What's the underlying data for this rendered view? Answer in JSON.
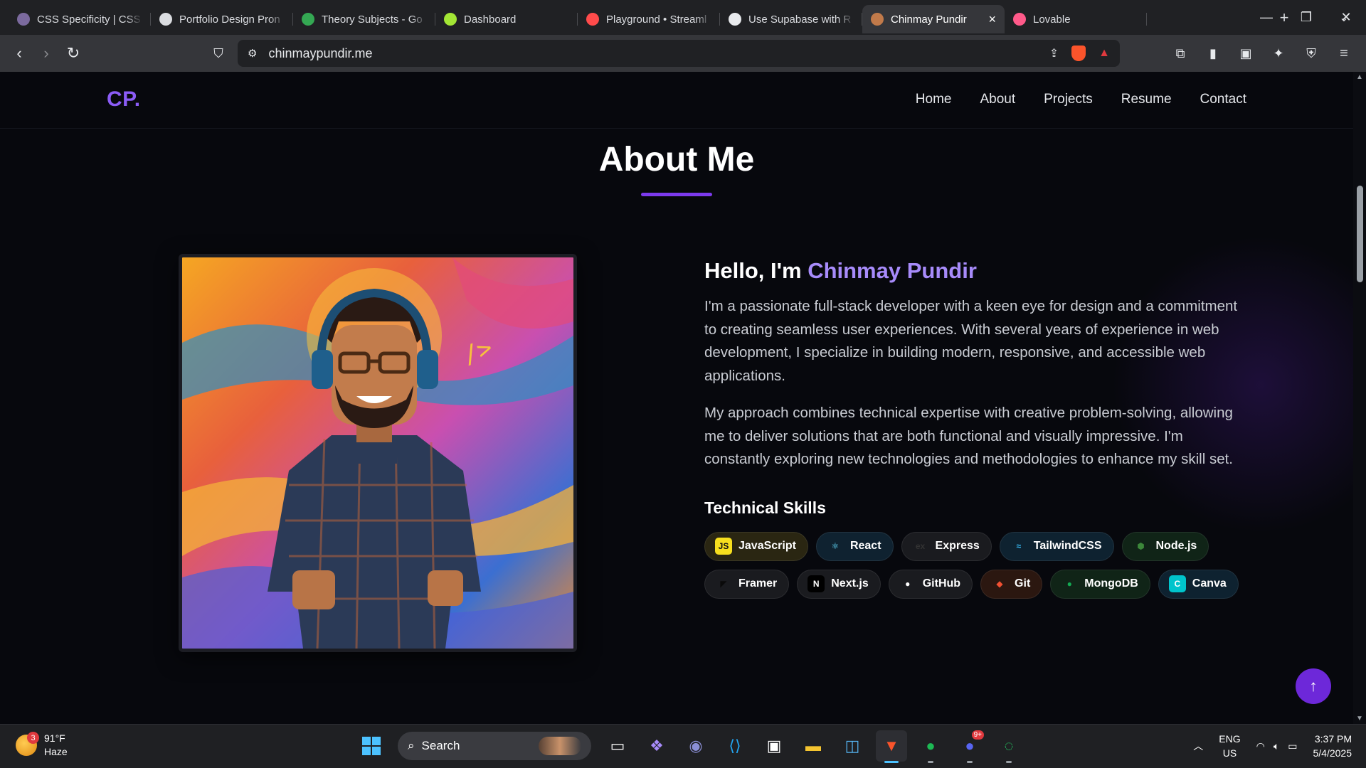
{
  "browser": {
    "tabs": [
      {
        "title": "CSS Specificity | CSS",
        "icon": "avatar-icon",
        "color": "#7b6a9e"
      },
      {
        "title": "Portfolio Design Pron",
        "icon": "openai-icon",
        "color": "#dadce0"
      },
      {
        "title": "Theory Subjects - Go",
        "icon": "google-drive-icon",
        "color": "#34a853"
      },
      {
        "title": "Dashboard",
        "icon": "bolt-icon",
        "color": "#a3e635"
      },
      {
        "title": "Playground • Streaml",
        "icon": "crown-icon",
        "color": "#ff4b4b"
      },
      {
        "title": "Use Supabase with R",
        "icon": "supabase-icon",
        "color": "#e8eaed"
      },
      {
        "title": "Chinmay Pundir",
        "icon": "avatar-icon",
        "color": "#c17a4a",
        "active": true
      },
      {
        "title": "Lovable",
        "icon": "lovable-icon",
        "color": "#ff5a8a"
      }
    ],
    "url": "chinmaypundir.me"
  },
  "site": {
    "logo": "CP.",
    "nav": [
      "Home",
      "About",
      "Projects",
      "Resume",
      "Contact"
    ],
    "section_title": "About Me",
    "accent": "#7c3aed",
    "greeting_prefix": "Hello, I'm ",
    "name": "Chinmay Pundir",
    "paragraphs": [
      "I'm a passionate full-stack developer with a keen eye for design and a commitment to creating seamless user experiences. With several years of experience in web development, I specialize in building modern, responsive, and accessible web applications.",
      "My approach combines technical expertise with creative problem-solving, allowing me to deliver solutions that are both functional and visually impressive. I'm constantly exploring new technologies and methodologies to enhance my skill set."
    ],
    "skills_title": "Technical Skills",
    "skills": [
      {
        "label": "JavaScript",
        "icon": "javascript-icon",
        "glyph": "JS",
        "bg": "#2a2612",
        "icon_bg": "#f7df1e",
        "icon_fg": "#111"
      },
      {
        "label": "React",
        "icon": "react-icon",
        "glyph": "⚛",
        "bg": "#0f2230",
        "icon_bg": "transparent",
        "icon_fg": "#61dafb"
      },
      {
        "label": "Express",
        "icon": "express-icon",
        "glyph": "ex",
        "bg": "#1a1b1f",
        "icon_bg": "transparent",
        "icon_fg": "#333"
      },
      {
        "label": "TailwindCSS",
        "icon": "tailwind-icon",
        "glyph": "≈",
        "bg": "#0e2230",
        "icon_bg": "transparent",
        "icon_fg": "#38bdf8"
      },
      {
        "label": "Node.js",
        "icon": "nodejs-icon",
        "glyph": "⬢",
        "bg": "#102417",
        "icon_bg": "transparent",
        "icon_fg": "#3c873a"
      },
      {
        "label": "Framer",
        "icon": "framer-icon",
        "glyph": "◤",
        "bg": "#1a1b1f",
        "icon_bg": "transparent",
        "icon_fg": "#0a0a0a"
      },
      {
        "label": "Next.js",
        "icon": "nextjs-icon",
        "glyph": "N",
        "bg": "#1a1b1f",
        "icon_bg": "#000",
        "icon_fg": "#fff"
      },
      {
        "label": "GitHub",
        "icon": "github-icon",
        "glyph": "●",
        "bg": "#1a1b1f",
        "icon_bg": "transparent",
        "icon_fg": "#fff"
      },
      {
        "label": "Git",
        "icon": "git-icon",
        "glyph": "◆",
        "bg": "#2b1710",
        "icon_bg": "transparent",
        "icon_fg": "#f05032"
      },
      {
        "label": "MongoDB",
        "icon": "mongodb-icon",
        "glyph": "●",
        "bg": "#102417",
        "icon_bg": "transparent",
        "icon_fg": "#13aa52"
      },
      {
        "label": "Canva",
        "icon": "canva-icon",
        "glyph": "C",
        "bg": "#0e2230",
        "icon_bg": "#00c4cc",
        "icon_fg": "#fff"
      }
    ]
  },
  "taskbar": {
    "weather_temp": "91°F",
    "weather_desc": "Haze",
    "weather_badge": "3",
    "search_label": "Search",
    "lang_top": "ENG",
    "lang_bottom": "US",
    "time": "3:37 PM",
    "date": "5/4/2025",
    "discord_badge": "9+"
  }
}
